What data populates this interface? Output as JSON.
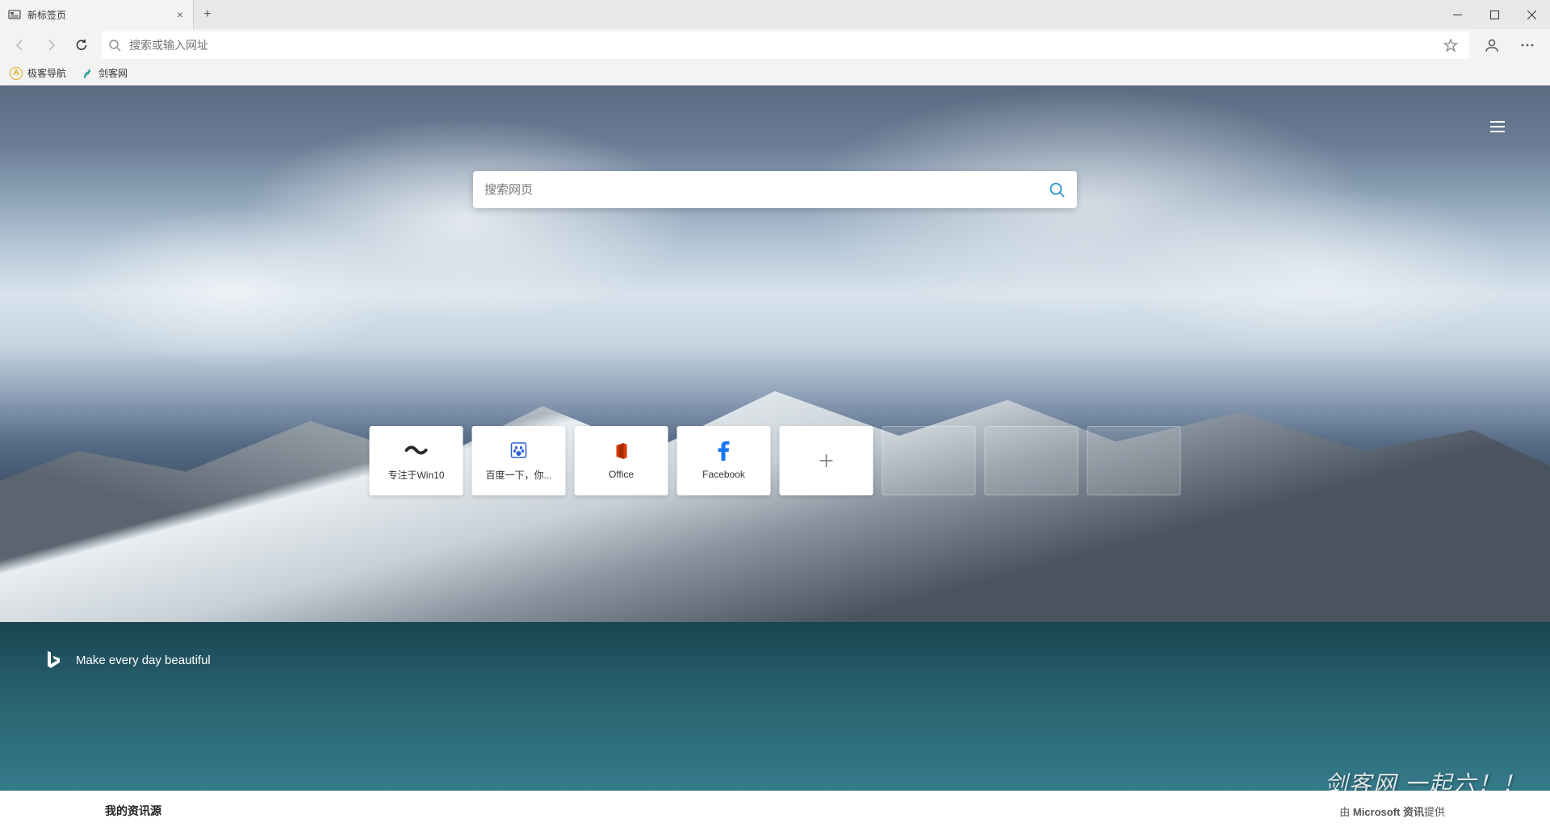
{
  "titlebar": {
    "tab_title": "新标签页",
    "close_glyph": "×",
    "new_tab_glyph": "+"
  },
  "toolbar": {
    "address_placeholder": "搜索或输入网址"
  },
  "bookmarks": [
    {
      "label": "极客导航",
      "icon": "geek-icon",
      "icon_color": "#e6a817"
    },
    {
      "label": "剑客网",
      "icon": "jianke-icon",
      "icon_color": "#2aa89a"
    }
  ],
  "ntp": {
    "search_placeholder": "搜索网页",
    "tiles": [
      {
        "label": "专注于Win10",
        "type": "site",
        "icon": "win10-icon",
        "color": "#2b2b2b"
      },
      {
        "label": "百度一下，你...",
        "type": "site",
        "icon": "baidu-icon",
        "color": "#2c5fd6"
      },
      {
        "label": "Office",
        "type": "site",
        "icon": "office-icon",
        "color": "#d83b01"
      },
      {
        "label": "Facebook",
        "type": "site",
        "icon": "facebook-icon",
        "color": "#1877f2"
      },
      {
        "label": "",
        "type": "add"
      },
      {
        "label": "",
        "type": "empty"
      },
      {
        "label": "",
        "type": "empty"
      },
      {
        "label": "",
        "type": "empty"
      }
    ],
    "bing_tagline": "Make every day beautiful"
  },
  "feed": {
    "title": "我的资讯源",
    "provider_prefix": "由 ",
    "provider_name": "Microsoft 资讯",
    "provider_suffix": "提供"
  },
  "watermark": "剑客网  一起六！！"
}
